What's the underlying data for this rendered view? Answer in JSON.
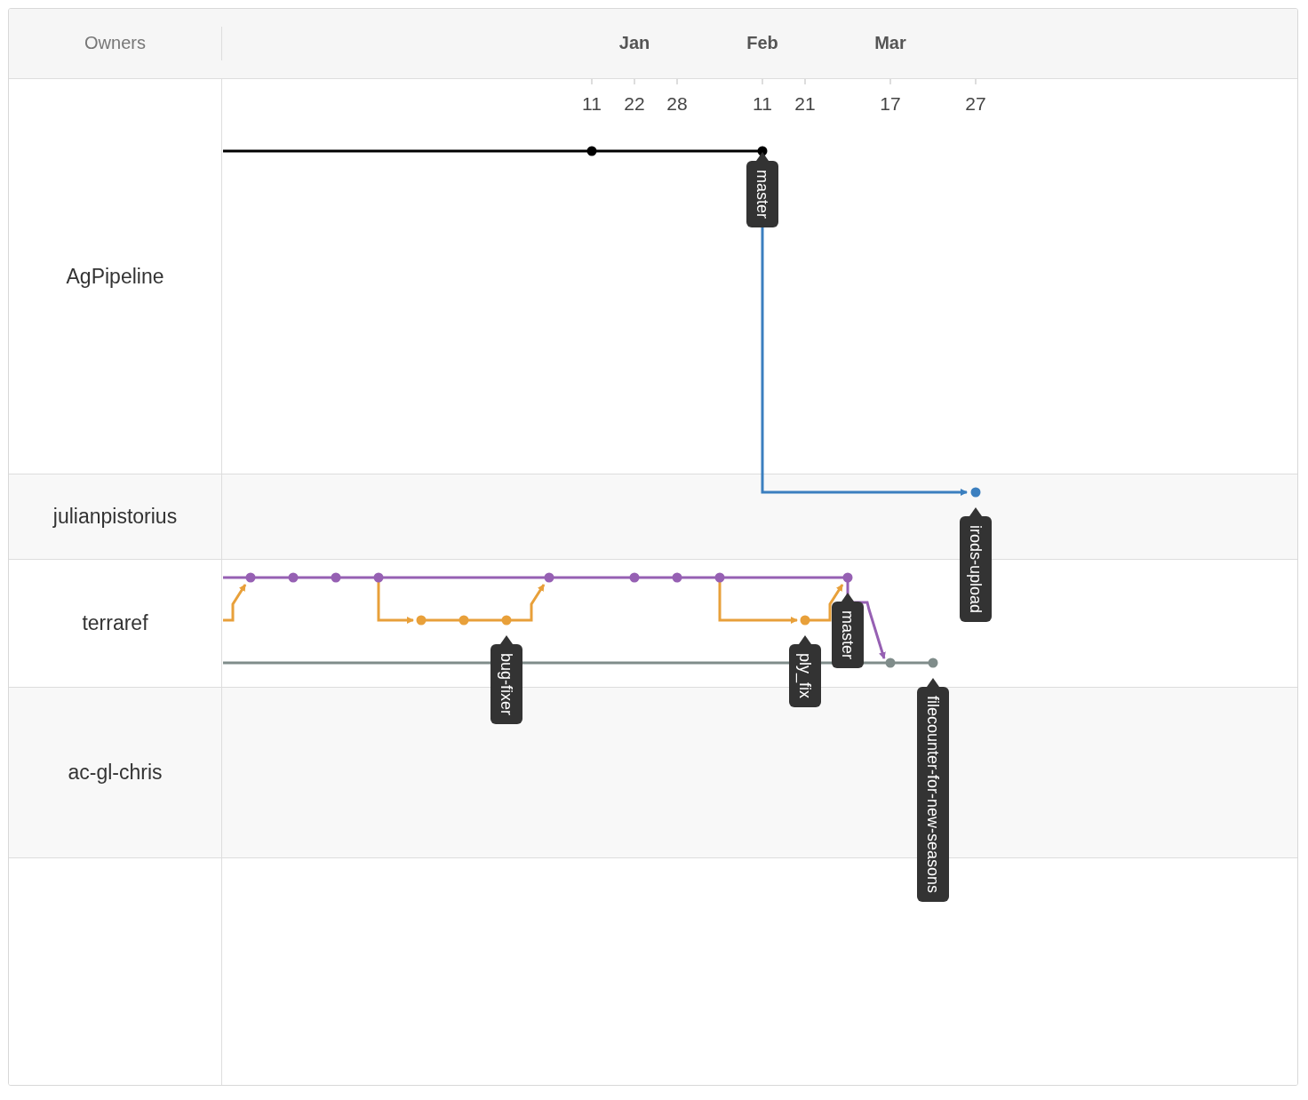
{
  "header": {
    "owners_label": "Owners",
    "months": [
      "Jan",
      "Feb",
      "Mar"
    ]
  },
  "day_ticks": [
    "11",
    "22",
    "28",
    "11",
    "21",
    "17",
    "27"
  ],
  "owners": [
    {
      "name": "AgPipeline"
    },
    {
      "name": "julianpistorius"
    },
    {
      "name": "terraref"
    },
    {
      "name": "ac-gl-chris"
    }
  ],
  "branch_tags": [
    {
      "label": "master"
    },
    {
      "label": "irods-upload"
    },
    {
      "label": "bug-fixer"
    },
    {
      "label": "ply_fix"
    },
    {
      "label": "master"
    },
    {
      "label": "filecounter-for-new-seasons"
    }
  ]
}
